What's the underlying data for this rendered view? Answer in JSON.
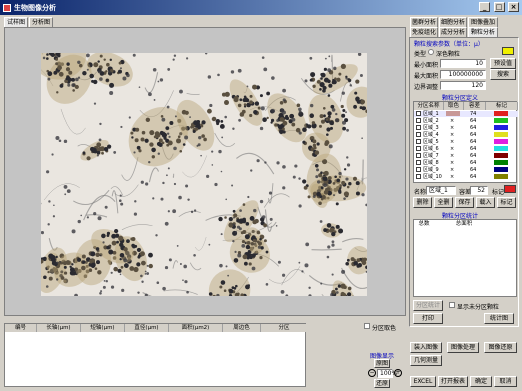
{
  "app": {
    "title": "生物图像分析"
  },
  "titlebar": {
    "min": "_",
    "max": "□",
    "close": "×"
  },
  "left_tabs": [
    "试样图",
    "分析图"
  ],
  "right_tabs_row1": [
    "菌群分析",
    "细胞分析",
    "图像叠加"
  ],
  "right_tabs_row2": [
    "免疫组化",
    "成分分析",
    "颗粒分析"
  ],
  "particle": {
    "search_header": "颗粒搜索参数（单位：μ）",
    "type_label": "类型",
    "type_value": "深色颗粒",
    "min_area_label": "最小面积",
    "min_area": "10",
    "max_area_label": "最大面积",
    "max_area": "100000000",
    "edge_label": "边界调整",
    "edge": "120",
    "preset_btn": "预设值",
    "search_btn": "搜索",
    "class_header": "颗粒分区定义",
    "cols": [
      "分区名称",
      "取色",
      "容差",
      "标记"
    ],
    "rows": [
      {
        "name": "区域_1",
        "pick": "",
        "tol": "74",
        "color": "#e02020"
      },
      {
        "name": "区域_2",
        "pick": "×",
        "tol": "64",
        "color": "#20c020"
      },
      {
        "name": "区域_3",
        "pick": "×",
        "tol": "64",
        "color": "#2020e0"
      },
      {
        "name": "区域_4",
        "pick": "×",
        "tol": "64",
        "color": "#e0e020"
      },
      {
        "name": "区域_5",
        "pick": "×",
        "tol": "64",
        "color": "#e020e0"
      },
      {
        "name": "区域_6",
        "pick": "×",
        "tol": "64",
        "color": "#20e0e0"
      },
      {
        "name": "区域_7",
        "pick": "×",
        "tol": "64",
        "color": "#800000"
      },
      {
        "name": "区域_8",
        "pick": "×",
        "tol": "64",
        "color": "#008000"
      },
      {
        "name": "区域_9",
        "pick": "×",
        "tol": "64",
        "color": "#000080"
      },
      {
        "name": "区域_10",
        "pick": "×",
        "tol": "64",
        "color": "#808000"
      }
    ],
    "name_label": "名称",
    "name_value": "区域_1",
    "tol_label": "容差",
    "tol_value": "52",
    "mark_label": "标记",
    "btns": [
      "删除",
      "全删",
      "保存",
      "载入",
      "标记"
    ],
    "stats_header": "颗粒分区统计",
    "stats_cols": [
      "总数",
      "总面积"
    ],
    "stats_btn": "分区统计",
    "show_unclassified": "显示未分区颗粒",
    "print_btn": "打印",
    "stats_table_btn": "统计图"
  },
  "results": {
    "cols": [
      "编号",
      "长轴(μm)",
      "短轴(μm)",
      "直径(μm)",
      "面积(μm2)",
      "周边色",
      "分区"
    ],
    "zone_color_label": "分区取色"
  },
  "zoom": {
    "label": "图像显示",
    "fit": "原图",
    "value": "100%",
    "restore": "还原"
  },
  "bottom": {
    "load": "装入图像",
    "process": "图像处理",
    "restore": "图像还原",
    "measure": "几何测量",
    "excel": "EXCEL",
    "report": "打开报表",
    "ok": "确定",
    "cancel": "取消"
  }
}
